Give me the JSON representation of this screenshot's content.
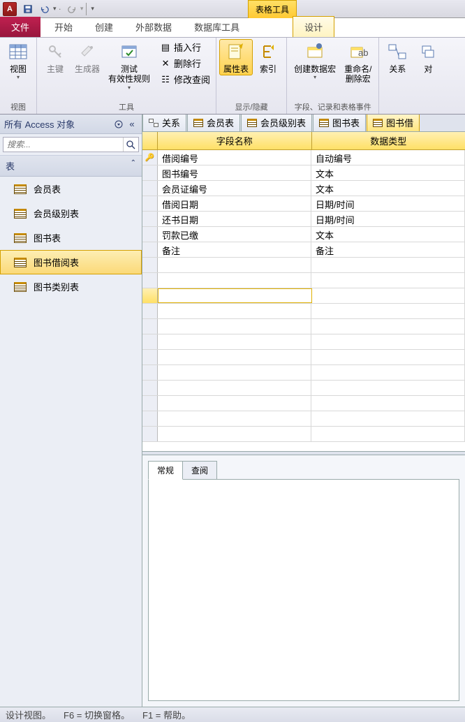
{
  "app_letter": "A",
  "context_tab": "表格工具",
  "ribbon_tabs": {
    "file": "文件",
    "home": "开始",
    "create": "创建",
    "external": "外部数据",
    "dbtools": "数据库工具",
    "design": "设计"
  },
  "ribbon": {
    "view": {
      "btn": "视图",
      "group": "视图"
    },
    "tools": {
      "pk": "主键",
      "builder": "生成器",
      "test": "测试\n有效性规则",
      "group": "工具"
    },
    "rows": {
      "insert": "插入行",
      "delete": "删除行",
      "modify": "修改查阅"
    },
    "showhide": {
      "propsheet": "属性表",
      "indexes": "索引",
      "group": "显示/隐藏"
    },
    "events": {
      "macro": "创建数据宏",
      "rename": "重命名/\n删除宏",
      "group": "字段、记录和表格事件"
    },
    "rel": {
      "rel": "关系",
      "obj": "对"
    }
  },
  "nav": {
    "title": "所有 Access 对象",
    "search_ph": "搜索...",
    "cat": "表",
    "items": [
      "会员表",
      "会员级别表",
      "图书表",
      "图书借阅表",
      "图书类别表"
    ],
    "selected": 3
  },
  "doctabs": [
    {
      "label": "关系",
      "type": "rel"
    },
    {
      "label": "会员表",
      "type": "tbl"
    },
    {
      "label": "会员级别表",
      "type": "tbl"
    },
    {
      "label": "图书表",
      "type": "tbl"
    },
    {
      "label": "图书借",
      "type": "tbl",
      "active": true
    }
  ],
  "grid": {
    "hdr_field": "字段名称",
    "hdr_type": "数据类型",
    "rows": [
      {
        "name": "借阅编号",
        "type": "自动编号",
        "pk": true
      },
      {
        "name": "图书编号",
        "type": "文本"
      },
      {
        "name": "会员证编号",
        "type": "文本"
      },
      {
        "name": "借阅日期",
        "type": "日期/时间"
      },
      {
        "name": "还书日期",
        "type": "日期/时间"
      },
      {
        "name": "罚款已缴",
        "type": "文本"
      },
      {
        "name": "备注",
        "type": "备注"
      }
    ]
  },
  "props": {
    "tab_general": "常规",
    "tab_lookup": "查阅"
  },
  "status": {
    "view": "设计视图。",
    "f6": "F6 = 切换窗格。",
    "f1": "F1 = 帮助。"
  }
}
